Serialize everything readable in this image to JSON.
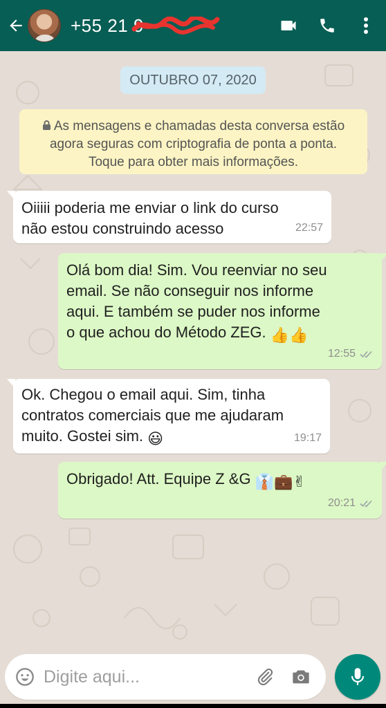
{
  "header": {
    "contact": "+55 21 9",
    "colors": {
      "bar": "#075e54"
    },
    "icons": [
      "back-arrow-icon",
      "video-call-icon",
      "phone-icon",
      "more-vert-icon"
    ]
  },
  "chat": {
    "date_chip": "OUTUBRO 07, 2020",
    "encryption_notice": "As mensagens e chamadas desta conversa estão agora seguras com criptografia de ponta a ponta. Toque para obter mais informações.",
    "messages": [
      {
        "direction": "incoming",
        "text": "Oiiiii poderia me enviar o link do curso\nnão estou construindo acesso",
        "time": "22:57"
      },
      {
        "direction": "outgoing",
        "text": "Olá bom dia! Sim. Vou reenviar no seu\nemail. Se não conseguir nos informe\naqui. E também se puder nos informe\no que achou do Método ZEG.",
        "emoji_suffix": "👍👍",
        "time": "12:55",
        "status": "read-ticks"
      },
      {
        "direction": "incoming",
        "text": "Ok. Chegou o email aqui. Sim, tinha\ncontratos comerciais que me ajudaram\nmuito. Gostei sim.",
        "emoji_suffix": "😃",
        "time": "19:17"
      },
      {
        "direction": "outgoing",
        "text": "Obrigado! Att. Equipe Z &G",
        "emoji_suffix": "👔💼✌",
        "time": "20:21",
        "status": "read-ticks"
      }
    ]
  },
  "composer": {
    "placeholder": "Digite aqui...",
    "accent": "#00897b"
  }
}
